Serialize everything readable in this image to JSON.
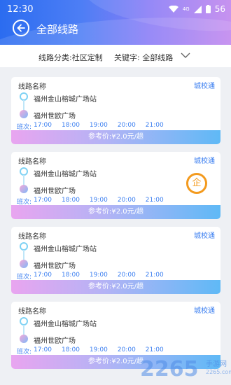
{
  "status": {
    "time": "12:30",
    "battery": "56",
    "network": "4G"
  },
  "header": {
    "title": "全部线路"
  },
  "filter": {
    "category": "线路分类:社区定制",
    "keyword": "关键字: 全部线路"
  },
  "cards": [
    {
      "name": "线路名称",
      "tag": "城校通",
      "from": "福州金山榕城广场站",
      "to": "福州世欧广场",
      "times_label": "班次:",
      "times": [
        "17:00",
        "18:00",
        "19:00",
        "20:00",
        "21:00"
      ],
      "price": "参考价:¥2.0元/趟"
    },
    {
      "name": "线路名称",
      "tag": "城校通",
      "from": "福州金山榕城广场站",
      "to": "福州世欧广场",
      "times_label": "班次:",
      "times": [
        "17:00",
        "18:00",
        "19:00",
        "20:00",
        "21:00"
      ],
      "price": "参考价:¥2.0元/趟"
    },
    {
      "name": "线路名称",
      "tag": "城校通",
      "from": "福州金山榕城广场站",
      "to": "福州世欧广场",
      "times_label": "班次:",
      "times": [
        "17:00",
        "18:00",
        "19:00",
        "20:00",
        "21:00"
      ],
      "price": "参考价:¥2.0元/趟"
    },
    {
      "name": "线路名称",
      "tag": "城校通",
      "from": "福州金山榕城广场站",
      "to": "福州世欧广场",
      "times_label": "班次:",
      "times": [
        "17:00",
        "18:00",
        "19:00",
        "20:00",
        "21:00"
      ],
      "price": "参考价:¥2.0元/趟"
    }
  ],
  "badge": {
    "label": "企"
  },
  "watermark": {
    "brand": "2265",
    "site": "手游网",
    "url": "2265.com"
  },
  "colors": {
    "accent": "#3a7ef0",
    "badge": "#f39a1e"
  }
}
